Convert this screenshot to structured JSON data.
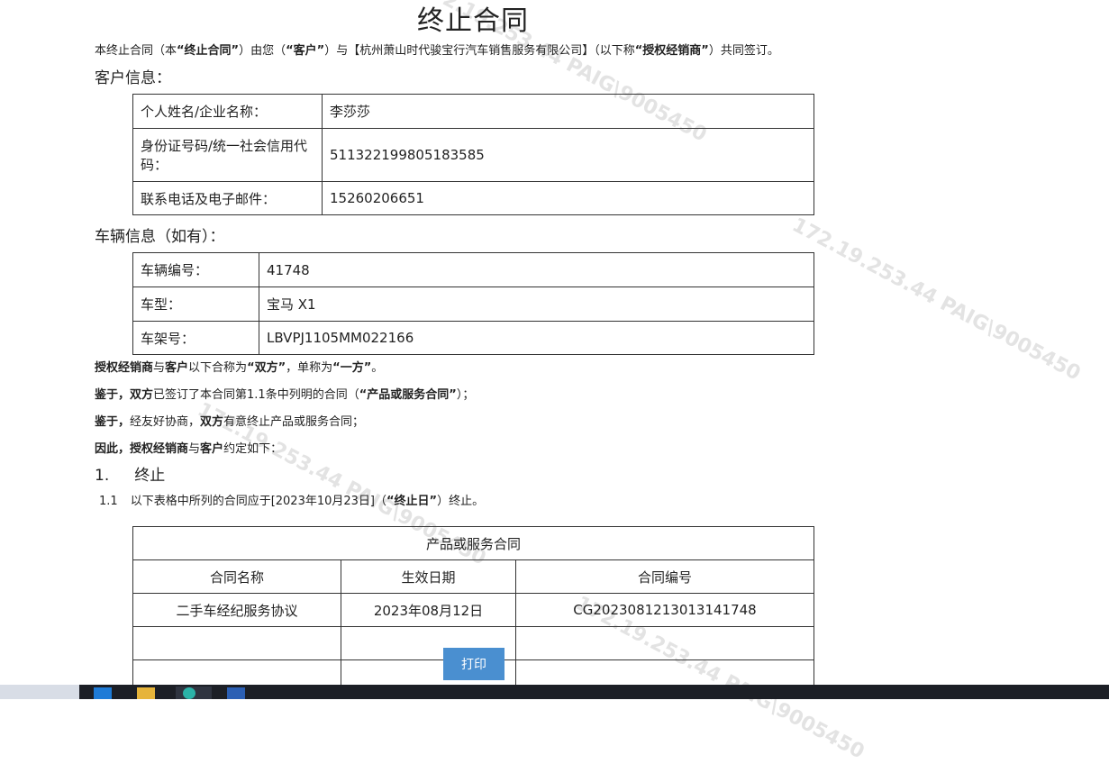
{
  "document": {
    "title": "终止合同",
    "intro": {
      "p1": "本终止合同（本",
      "b1": "“终止合同”",
      "p2": "）由您（",
      "b2": "“客户”",
      "p3": "）与【杭州萧山时代骏宝行汽车销售服务有限公司】（以下称",
      "b3": "“授权经销商”",
      "p4": "）共同签订。"
    },
    "customer_heading": "客户信息：",
    "customer": {
      "name_label": "个人姓名/企业名称：",
      "name_value": "李莎莎",
      "id_label": "身份证号码/统一社会信用代码：",
      "id_value": "511322199805183585",
      "contact_label": "联系电话及电子邮件：",
      "contact_value": "15260206651"
    },
    "vehicle_heading": "车辆信息（如有）：",
    "vehicle": {
      "no_label": "车辆编号：",
      "no_value": "41748",
      "model_label": "车型：",
      "model_value": "宝马 X1",
      "vin_label": "车架号：",
      "vin_value": "LBVPJ1105MM022166"
    },
    "party_line": {
      "b1": "授权经销商",
      "p1": "与",
      "b2": "客户",
      "p2": "以下合称为",
      "b3": "“双方”",
      "p3": "，单称为",
      "b4": "“一方”",
      "p4": "。"
    },
    "whereas1": {
      "b1": "鉴于，",
      "b2": "双方",
      "p1": "已签订了本合同第1.1条中列明的合同（",
      "b3": "“产品或服务合同”",
      "p2": "）；"
    },
    "whereas2": {
      "b1": "鉴于，",
      "p1": "经友好协商，",
      "b2": "双方",
      "p2": "有意终止产品或服务合同；"
    },
    "therefore": {
      "b1": "因此，",
      "b2": "授权经销商",
      "p1": "与",
      "b2b": "客户",
      "p2": "约定如下："
    },
    "section1": {
      "num": "1.",
      "title": "终止"
    },
    "clause11": {
      "num": "1.1",
      "p1": "以下表格中所列的合同应于[2023年10月23日]（",
      "b1": "“终止日”",
      "p2": "）终止。"
    },
    "contracts_table": {
      "caption": "产品或服务合同",
      "headers": [
        "合同名称",
        "生效日期",
        "合同编号"
      ],
      "rows": [
        [
          "二手车经纪服务协议",
          "2023年08月12日",
          "CG2023081213013141748"
        ]
      ]
    },
    "print_button": "打印",
    "watermark": "172.19.253.44  PAIG\\9005450"
  }
}
